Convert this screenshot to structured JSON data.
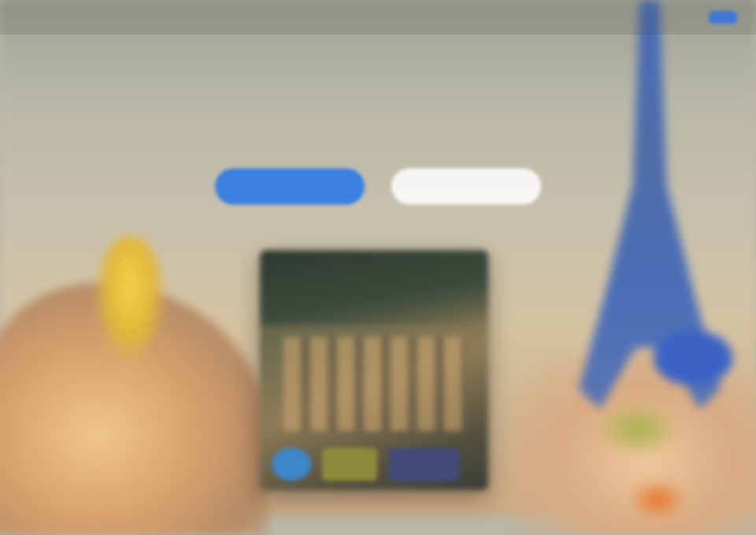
{
  "nav": {
    "logo": "",
    "links": [
      "",
      ""
    ],
    "cta_label": ""
  },
  "hero": {
    "title": "",
    "subtitle": "",
    "primary_button": "",
    "secondary_button": ""
  },
  "colors": {
    "accent": "#3b7fe0",
    "secondary_button_bg": "#ffffff"
  },
  "card": {
    "image": "building-photo",
    "badges": [
      "badge-blue",
      "badge-olive",
      "badge-navy"
    ]
  }
}
